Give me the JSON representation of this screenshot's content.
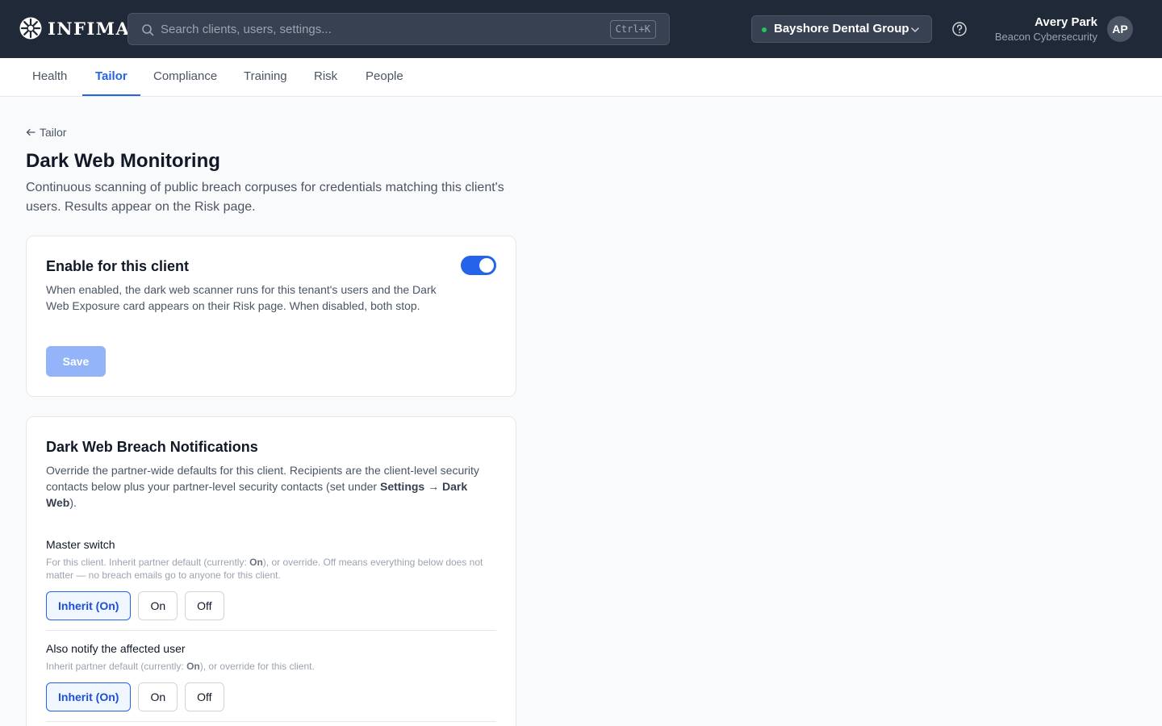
{
  "brand": {
    "name": "INFIMA"
  },
  "search": {
    "placeholder": "Search clients, users, settings...",
    "shortcut": "Ctrl+K"
  },
  "client_selector": {
    "selected": "Bayshore Dental Group",
    "status_color": "#22c55e"
  },
  "user": {
    "name": "Avery Park",
    "org": "Beacon Cybersecurity",
    "initials": "AP"
  },
  "tabs": [
    {
      "label": "Health",
      "active": false
    },
    {
      "label": "Tailor",
      "active": true
    },
    {
      "label": "Compliance",
      "active": false
    },
    {
      "label": "Training",
      "active": false
    },
    {
      "label": "Risk",
      "active": false
    },
    {
      "label": "People",
      "active": false
    }
  ],
  "breadcrumb": {
    "back_label": "Tailor"
  },
  "page": {
    "title": "Dark Web Monitoring",
    "description": "Continuous scanning of public breach corpuses for credentials matching this client's users. Results appear on the Risk page."
  },
  "enable_card": {
    "title": "Enable for this client",
    "description": "When enabled, the dark web scanner runs for this tenant's users and the Dark Web Exposure card appears on their Risk page. When disabled, both stop.",
    "enabled": true,
    "save_label": "Save"
  },
  "notifications_card": {
    "title": "Dark Web Breach Notifications",
    "description_part1": "Override the partner-wide defaults for this client. Recipients are the client-level security contacts below plus your partner-level security contacts (set under ",
    "description_bold": "Settings → Dark Web",
    "description_part2": ").",
    "settings": [
      {
        "label": "Master switch",
        "help_part1": "For this client. Inherit partner default (currently: ",
        "help_bold": "On",
        "help_part2": "), or override. Off means everything below does not matter — no breach emails go to anyone for this client.",
        "options": [
          "Inherit (On)",
          "On",
          "Off"
        ],
        "selected": "Inherit (On)"
      },
      {
        "label": "Also notify the affected user",
        "help_part1": "Inherit partner default (currently: ",
        "help_bold": "On",
        "help_part2": "), or override for this client.",
        "options": [
          "Inherit (On)",
          "On",
          "Off"
        ],
        "selected": "Inherit (On)"
      }
    ]
  },
  "colors": {
    "accent": "#2563eb",
    "topbar": "#1f2937"
  }
}
